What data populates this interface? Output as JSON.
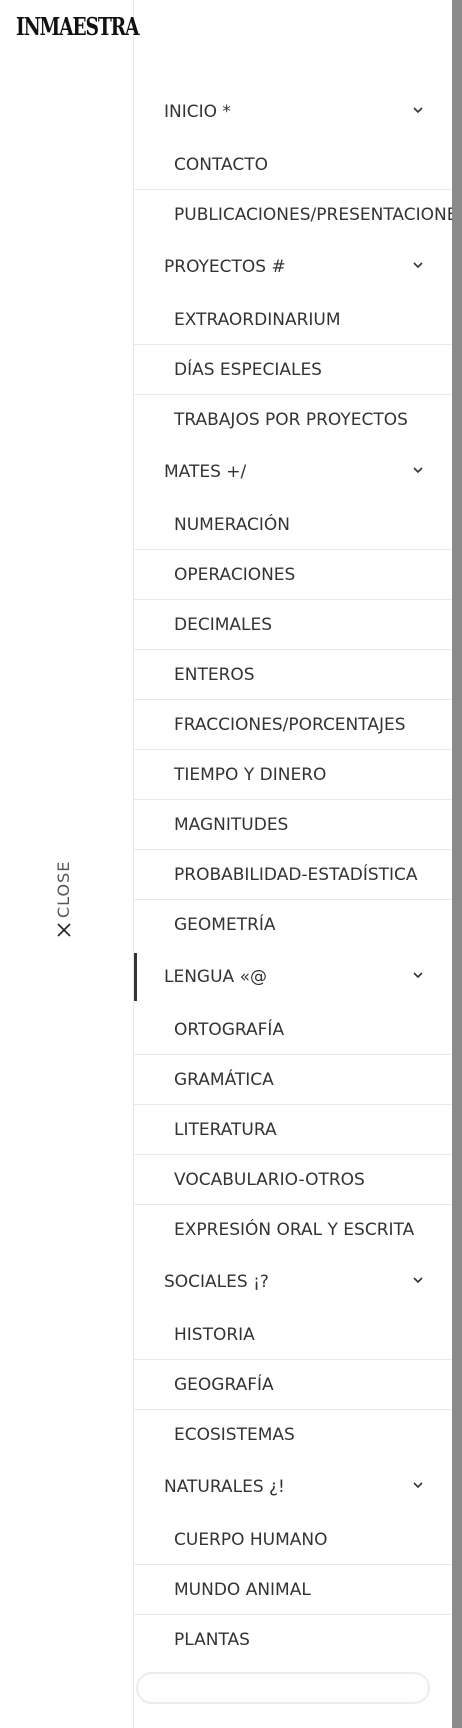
{
  "brand": {
    "logo_text": "INMAESTRA"
  },
  "close": {
    "label": "CLOSE"
  },
  "menu": [
    {
      "label": "INICIO *",
      "active": false,
      "children": [
        "CONTACTO",
        "PUBLICACIONES/PRESENTACIONES"
      ]
    },
    {
      "label": "PROYECTOS #",
      "active": false,
      "children": [
        "EXTRAORDINARIUM",
        "DÍAS ESPECIALES",
        "TRABAJOS POR PROYECTOS"
      ]
    },
    {
      "label": "MATES +/",
      "active": false,
      "children": [
        "NUMERACIÓN",
        "OPERACIONES",
        "DECIMALES",
        "ENTEROS",
        "FRACCIONES/PORCENTAJES",
        "TIEMPO Y DINERO",
        "MAGNITUDES",
        "PROBABILIDAD-ESTADÍSTICA",
        "GEOMETRÍA"
      ]
    },
    {
      "label": "LENGUA «@",
      "active": true,
      "children": [
        "ORTOGRAFÍA",
        "GRAMÁTICA",
        "LITERATURA",
        "VOCABULARIO-OTROS",
        "EXPRESIÓN ORAL Y ESCRITA"
      ]
    },
    {
      "label": "SOCIALES ¡?",
      "active": false,
      "children": [
        "HISTORIA",
        "GEOGRAFÍA",
        "ECOSISTEMAS"
      ]
    },
    {
      "label": "NATURALES ¿!",
      "active": false,
      "children": [
        "CUERPO HUMANO",
        "MUNDO ANIMAL",
        "PLANTAS"
      ]
    }
  ],
  "icons": {
    "chevron": "chevron-down-icon",
    "close": "close-icon"
  },
  "colors": {
    "text": "#333333",
    "divider": "#e9e9e9",
    "scrollbar": "#8a8a8a",
    "active_indicator": "#333333"
  }
}
